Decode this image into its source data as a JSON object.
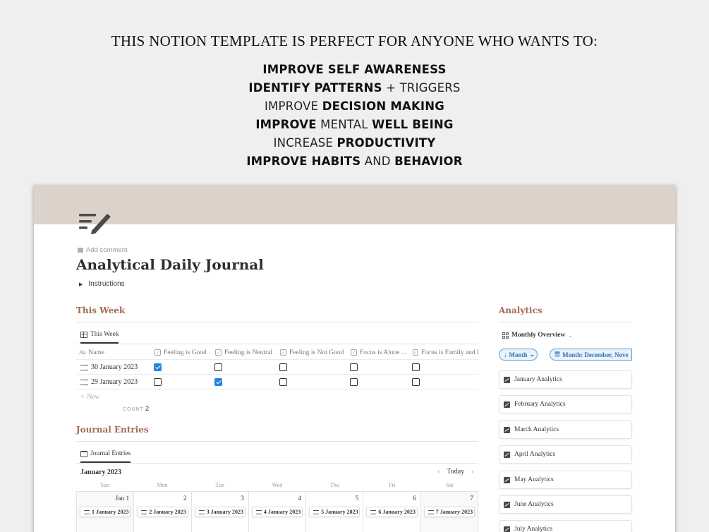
{
  "promo": {
    "headline": "THIS NOTION TEMPLATE IS PERFECT FOR ANYONE WHO WANTS TO:",
    "benefits": [
      {
        "bold1": "IMPROVE SELF AWARENESS",
        "thin1": "",
        "bold2": "",
        "thin2": ""
      },
      {
        "bold1": "IDENTIFY PATTERNS",
        "thin1": " + TRIGGERS",
        "bold2": "",
        "thin2": ""
      },
      {
        "bold1": "",
        "thin1": "IMPROVE ",
        "bold2": "DECISION MAKING",
        "thin2": ""
      },
      {
        "bold1": "IMPROVE",
        "thin1": " MENTAL ",
        "bold2": "WELL BEING",
        "thin2": ""
      },
      {
        "bold1": "",
        "thin1": "INCREASE ",
        "bold2": "PRODUCTIVITY",
        "thin2": ""
      },
      {
        "bold1": "IMPROVE HABITS",
        "thin1": " AND ",
        "bold2": "BEHAVIOR",
        "thin2": ""
      }
    ]
  },
  "page": {
    "add_comment": "Add comment",
    "title": "Analytical Daily Journal",
    "instructions": "Instructions",
    "cover_color": "#ddd2c9",
    "accent_color": "#a56a50"
  },
  "this_week": {
    "heading": "This Week",
    "tab": "This Week",
    "columns": [
      "Name",
      "Feeling is Good",
      "Feeling is Neutral",
      "Feeling is Not Good",
      "Focus is Alone ...",
      "Focus is Family and F"
    ],
    "rows": [
      {
        "name": "30 January 2023",
        "checks": [
          true,
          false,
          false,
          false,
          false
        ]
      },
      {
        "name": "29 January 2023",
        "checks": [
          false,
          true,
          false,
          false,
          false
        ]
      }
    ],
    "new_label": "New",
    "count_label": "COUNT",
    "count_value": "2"
  },
  "journal": {
    "heading": "Journal Entries",
    "tab": "Journal Entries",
    "month": "January 2023",
    "today": "Today",
    "weekdays": [
      "Sun",
      "Mon",
      "Tue",
      "Wed",
      "Thu",
      "Fri",
      "Sat"
    ],
    "days": [
      {
        "num": "Jan 1",
        "entry": "1 January 2023"
      },
      {
        "num": "2",
        "entry": "2 January 2023"
      },
      {
        "num": "3",
        "entry": "3 January 2023"
      },
      {
        "num": "4",
        "entry": "4 January 2023"
      },
      {
        "num": "5",
        "entry": "5 January 2023"
      },
      {
        "num": "6",
        "entry": "6 January 2023"
      },
      {
        "num": "7",
        "entry": "7 January 2023"
      }
    ]
  },
  "analytics": {
    "heading": "Analytics",
    "view_tab": "Monthly Overview",
    "sort_chip": "Month",
    "filter_chip": "Month: December, Nove",
    "items": [
      "January Analytics",
      "February Analytics",
      "March Analytics",
      "April Analytics",
      "May Analytics",
      "June Analytics",
      "July Analytics"
    ]
  }
}
